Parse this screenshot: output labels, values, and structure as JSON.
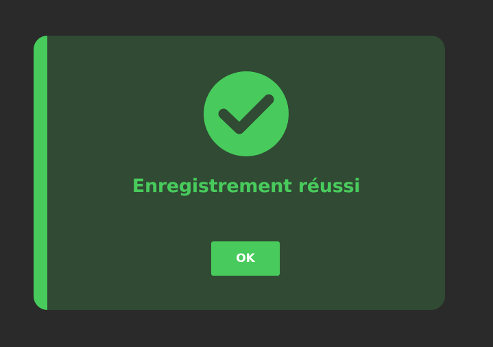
{
  "dialog": {
    "title": "Enregistrement réussi",
    "ok_label": "OK",
    "icon": "check-circle-icon",
    "colors": {
      "accent": "#48cb5c",
      "dialog_background": "#304a33",
      "page_background": "#2a2a2a",
      "button_text": "#ffffff"
    }
  }
}
